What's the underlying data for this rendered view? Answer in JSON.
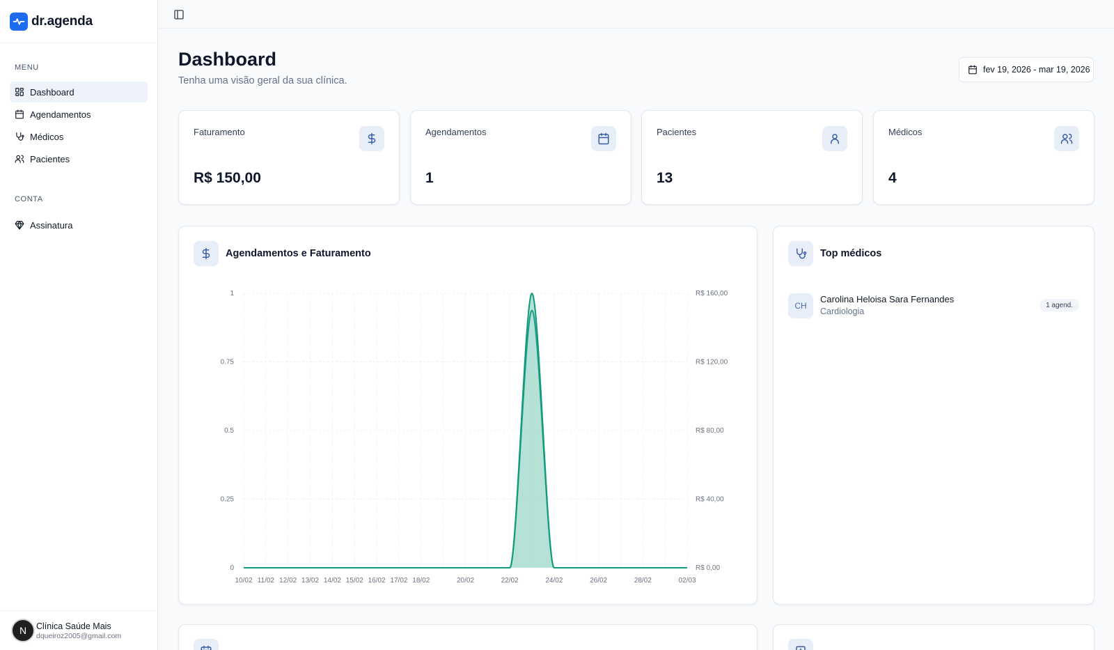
{
  "brand": {
    "name": "dr.agenda"
  },
  "sidebar": {
    "menu_label": "MENU",
    "items": [
      {
        "label": "Dashboard",
        "icon": "layout-grid-icon",
        "active": true
      },
      {
        "label": "Agendamentos",
        "icon": "calendar-icon"
      },
      {
        "label": "Médicos",
        "icon": "stethoscope-icon"
      },
      {
        "label": "Pacientes",
        "icon": "users-icon"
      }
    ],
    "account_label": "CONTA",
    "account_items": [
      {
        "label": "Assinatura",
        "icon": "gem-icon"
      }
    ]
  },
  "user": {
    "initial": "N",
    "name": "Clínica Saúde Mais",
    "email": "dqueiroz2005@gmail.com"
  },
  "header": {
    "title": "Dashboard",
    "subtitle": "Tenha uma visão geral da sua clínica.",
    "date_range": "fev 19, 2026 - mar 19, 2026"
  },
  "stats": [
    {
      "label": "Faturamento",
      "value": "R$ 150,00",
      "icon": "dollar-icon"
    },
    {
      "label": "Agendamentos",
      "value": "1",
      "icon": "calendar-icon"
    },
    {
      "label": "Pacientes",
      "value": "13",
      "icon": "user-icon"
    },
    {
      "label": "Médicos",
      "value": "4",
      "icon": "users-icon"
    }
  ],
  "chart_panel": {
    "title": "Agendamentos e Faturamento"
  },
  "chart_data": {
    "type": "area",
    "x": [
      "10/02",
      "11/02",
      "12/02",
      "13/02",
      "14/02",
      "15/02",
      "16/02",
      "17/02",
      "18/02",
      "20/02",
      "22/02",
      "24/02",
      "26/02",
      "28/02",
      "02/03"
    ],
    "x_days": [
      0,
      1,
      2,
      3,
      4,
      5,
      6,
      7,
      8,
      10,
      12,
      14,
      16,
      18,
      20
    ],
    "peak_day": 13,
    "series": [],
    "agendamentos_values": [
      0,
      0,
      0,
      0,
      0,
      0,
      0,
      0,
      0,
      0,
      0,
      1,
      0,
      0,
      0
    ],
    "faturamento_values": [
      0,
      0,
      0,
      0,
      0,
      0,
      0,
      0,
      0,
      0,
      0,
      150,
      0,
      0,
      0
    ],
    "y_left_ticks": [
      "0",
      "0.25",
      "0.5",
      "0.75",
      "1"
    ],
    "y_right_ticks": [
      "R$ 0,00",
      "R$ 40,00",
      "R$ 80,00",
      "R$ 120,00",
      "R$ 160,00"
    ],
    "ylim_left": [
      0,
      1
    ],
    "ylim_right": [
      0,
      160
    ],
    "colors": {
      "agendamentos": "#0f9a7a",
      "faturamento": "#1f9e8a",
      "fill": "#a8dccf"
    },
    "grid": true
  },
  "top_doctors": {
    "title": "Top médicos",
    "items": [
      {
        "initials": "CH",
        "name": "Carolina Heloisa Sara Fernandes",
        "specialty": "Cardiologia",
        "badge": "1 agend."
      }
    ]
  }
}
